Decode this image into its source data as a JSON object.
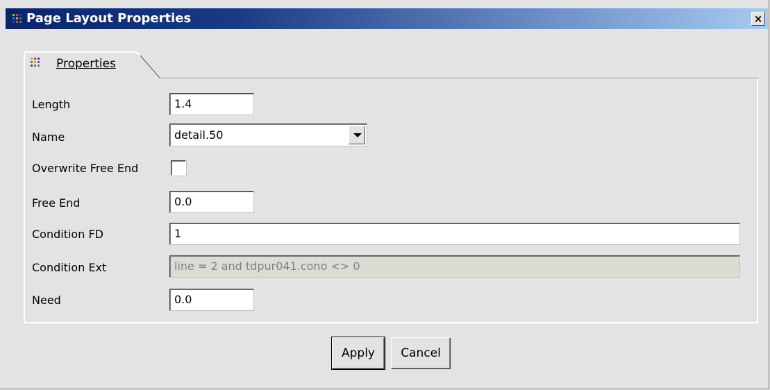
{
  "window": {
    "title": "Page Layout Properties",
    "close_label": "×"
  },
  "icon_colors": [
    "#d0b000",
    "#d04040",
    "#2040d0",
    "#20a040",
    "#d0b000",
    "#a040c0",
    "#2040d0",
    "#d04040",
    "#20a040"
  ],
  "tabs": [
    {
      "label": "Properties",
      "icon": "grid-icon",
      "selected": true
    }
  ],
  "fields": {
    "length": {
      "label": "Length",
      "value": "1.4"
    },
    "name": {
      "label": "Name",
      "value": "detail.50",
      "icon": "chevron-down-icon"
    },
    "overwrite_free_end": {
      "label": "Overwrite Free End",
      "checked": false
    },
    "free_end": {
      "label": "Free End",
      "value": "0.0"
    },
    "condition_fd": {
      "label": "Condition FD",
      "value": "1"
    },
    "condition_ext": {
      "label": "Condition Ext",
      "value": "line = 2 and tdpur041.cono <> 0",
      "disabled": true
    },
    "need": {
      "label": "Need",
      "value": "0.0"
    }
  },
  "buttons": {
    "apply": "Apply",
    "cancel": "Cancel"
  }
}
